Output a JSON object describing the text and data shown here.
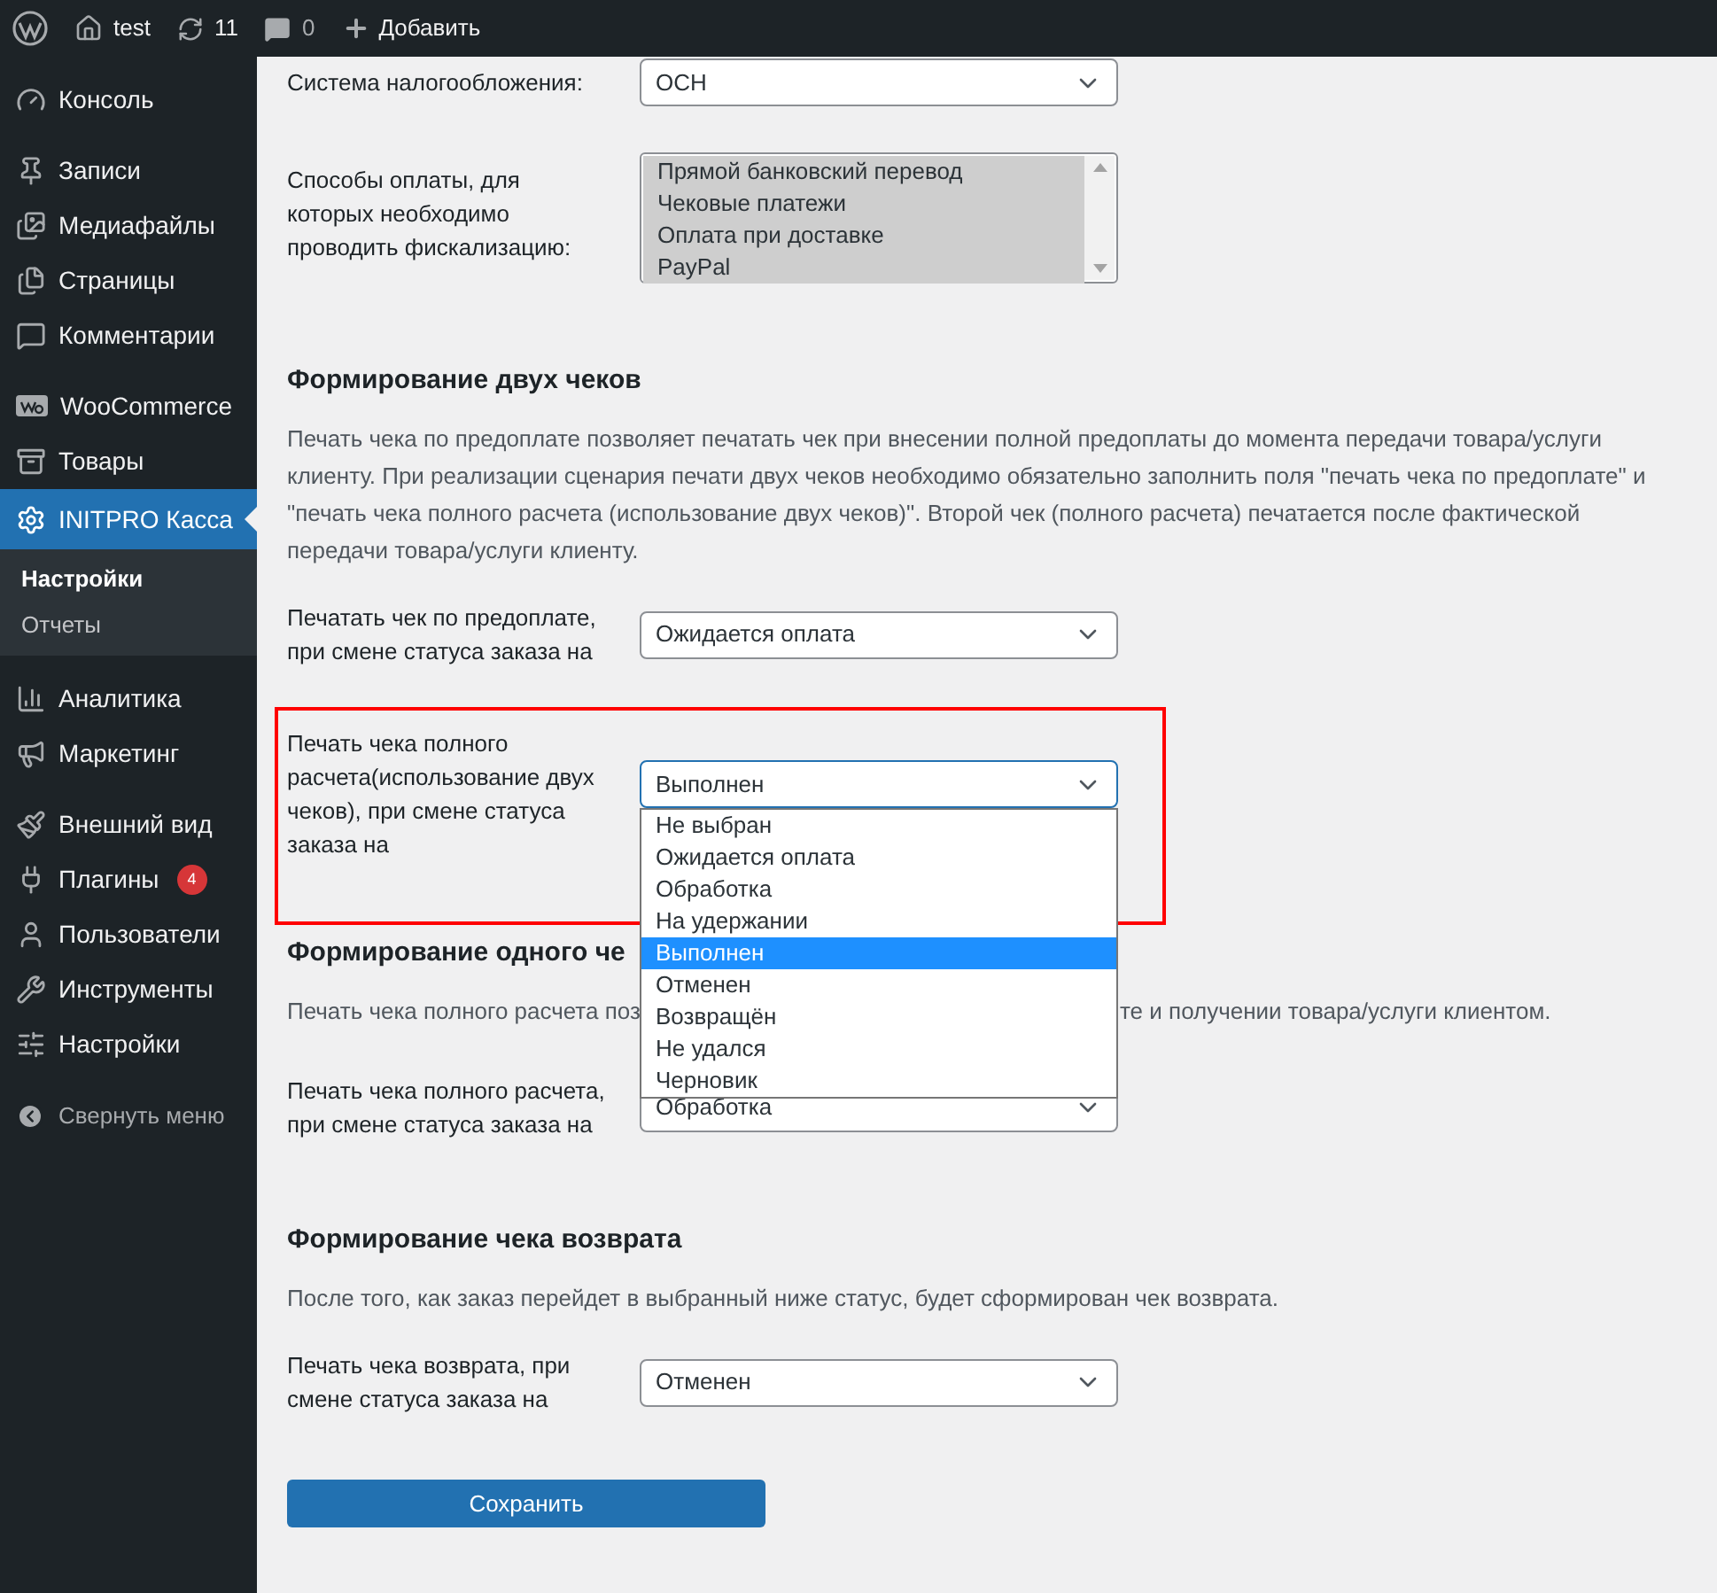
{
  "admin_bar": {
    "site": "test",
    "updates": "11",
    "comments": "0",
    "new": "Добавить"
  },
  "sidebar": {
    "groups": [
      [
        {
          "label": "Консоль",
          "selected": false
        }
      ],
      [
        {
          "label": "Записи",
          "selected": false
        },
        {
          "label": "Медиафайлы",
          "selected": false
        },
        {
          "label": "Страницы",
          "selected": false
        },
        {
          "label": "Комментарии",
          "selected": false
        }
      ],
      [
        {
          "label": "WooCommerce",
          "selected": false
        },
        {
          "label": "Товары",
          "selected": false
        },
        {
          "label": "INITPRO Касса",
          "selected": true,
          "children": [
            {
              "label": "Настройки",
              "selected": true
            },
            {
              "label": "Отчеты",
              "selected": false
            }
          ]
        }
      ],
      [
        {
          "label": "Аналитика",
          "selected": false
        },
        {
          "label": "Маркетинг",
          "selected": false
        }
      ],
      [
        {
          "label": "Внешний вид",
          "selected": false
        },
        {
          "label": "Плагины",
          "selected": false,
          "badge": "4"
        },
        {
          "label": "Пользователи",
          "selected": false
        },
        {
          "label": "Инструменты",
          "selected": false
        },
        {
          "label": "Настройки",
          "selected": false
        }
      ]
    ],
    "collapse_label": "Свернуть меню"
  },
  "sections": [
    {
      "rows": [
        {
          "kind": "select",
          "label": "Система налогообложения:",
          "value": "ОСН"
        },
        {
          "kind": "listbox",
          "label": "Способы оплаты, для которых необходимо проводить фискализацию:",
          "options": [
            {
              "label": "Прямой банковский перевод",
              "selected": true
            },
            {
              "label": "Чековые платежи",
              "selected": true
            },
            {
              "label": "Оплата при доставке",
              "selected": true
            },
            {
              "label": "PayPal",
              "selected": true
            }
          ]
        }
      ]
    },
    {
      "heading": "Формирование двух чеков",
      "description": "Печать чека по предоплате позволяет печатать чек при внесении полной предоплаты до момента передачи товара/услуги клиенту. При реализации сценария печати двух чеков необходимо обязательно заполнить поля \"печать чека по предоплате\" и \"печать чека полного расчета (использование двух чеков)\". Второй чек (полного расчета) печатается после фактической передачи товара/услуги клиенту.",
      "rows": [
        {
          "kind": "select",
          "label": "Печатать чек по предоплате, при смене статуса заказа на",
          "value": "Ожидается оплата"
        },
        {
          "kind": "select",
          "label": "Печать чека полного расчета(использование двух чеков), при смене статуса заказа на",
          "value": "Выполнен",
          "highlighted": true,
          "expanded": true,
          "options": [
            {
              "label": "Не выбран",
              "selected": false
            },
            {
              "label": "Ожидается оплата",
              "selected": false
            },
            {
              "label": "Обработка",
              "selected": false
            },
            {
              "label": "На удержании",
              "selected": false
            },
            {
              "label": "Выполнен",
              "selected": true
            },
            {
              "label": "Отменен",
              "selected": false
            },
            {
              "label": "Возвращён",
              "selected": false
            },
            {
              "label": "Не удался",
              "selected": false
            },
            {
              "label": "Черновик",
              "selected": false
            }
          ]
        }
      ]
    },
    {
      "heading": "Формирование одного че",
      "description_parts": [
        "Печать чека полного расчета поз",
        "те и получении товара/услуги клиентом."
      ],
      "rows": [
        {
          "kind": "select",
          "label": "Печать чека полного расчета, при смене статуса заказа на",
          "value": "Обработка"
        }
      ]
    },
    {
      "heading": "Формирование чека возврата",
      "description": "После того, как заказ перейдет в выбранный ниже статус, будет сформирован чек возврата.",
      "rows": [
        {
          "kind": "select",
          "label": "Печать чека возврата, при смене статуса заказа на",
          "value": "Отменен"
        }
      ]
    }
  ],
  "save_button": "Сохранить"
}
